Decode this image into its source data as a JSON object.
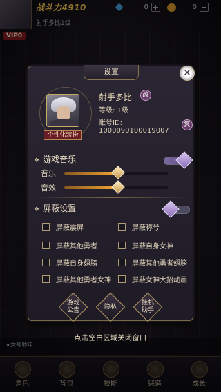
{
  "hud": {
    "power_text": "战斗力4910",
    "resources": [
      {
        "icon": "diamond-icon",
        "value": "0",
        "color": "#4aa8e8"
      },
      {
        "icon": "gold-coin-icon",
        "value": "0",
        "color": "#e8a030"
      }
    ],
    "friend_line": "射手多比1级",
    "vip_label": "VIP0",
    "bottom_hint": "点击空白区域关闭窗口",
    "chat_text": "★女神助阵...",
    "nav": [
      "角色",
      "背包",
      "技能",
      "锻造",
      "成长"
    ]
  },
  "dialog": {
    "title": "设置",
    "close_icon": "close-icon",
    "profile": {
      "name": "射手多比",
      "rename_label": "改",
      "level": "等级:  1级",
      "account_id": "账号ID:  1000090100019007",
      "copy_label": "复",
      "custom_tag": "个性化装扮"
    },
    "music_section": {
      "title": "游戏音乐",
      "enabled": true,
      "music_label": "音乐",
      "music_value": 0.52,
      "sfx_label": "音效",
      "sfx_value": 0.52
    },
    "shield_section": {
      "title": "屏蔽设置",
      "enabled": false,
      "options": [
        {
          "label": "屏蔽震屏",
          "checked": false
        },
        {
          "label": "屏蔽称号",
          "checked": false
        },
        {
          "label": "屏蔽其他勇者",
          "checked": false
        },
        {
          "label": "屏蔽自身女神",
          "checked": false
        },
        {
          "label": "屏蔽自身翅膀",
          "checked": false
        },
        {
          "label": "屏蔽其他勇者翅膀",
          "checked": false
        },
        {
          "label": "屏蔽其他勇者女神",
          "checked": false
        },
        {
          "label": "屏蔽女神大招动画",
          "checked": false
        }
      ]
    },
    "footer": [
      {
        "label_line1": "游戏",
        "label_line2": "公告"
      },
      {
        "label_line1": "隐私",
        "label_line2": ""
      },
      {
        "label_line1": "挂机",
        "label_line2": "助手"
      }
    ]
  }
}
